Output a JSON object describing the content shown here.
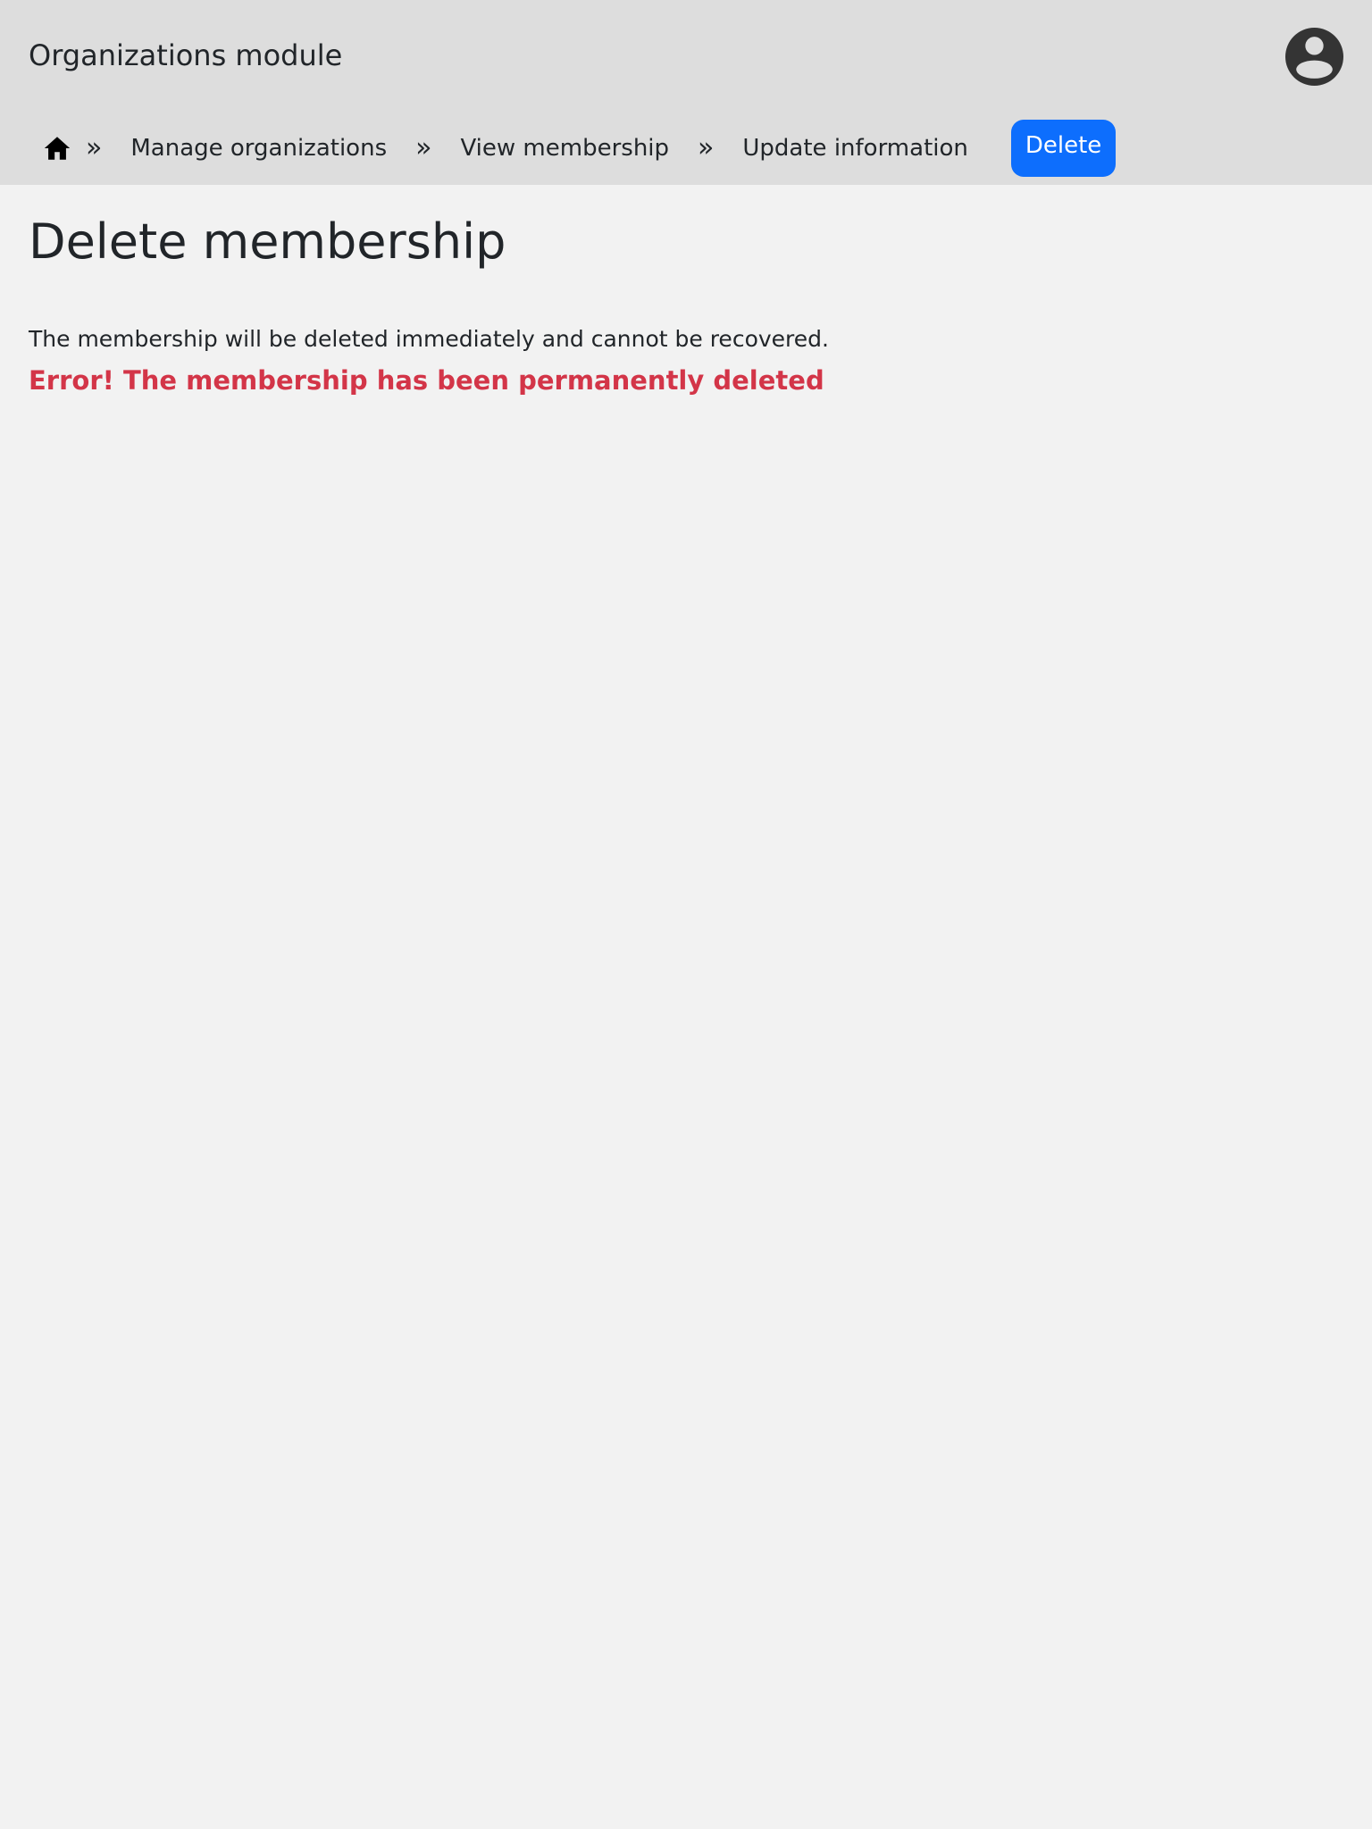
{
  "header": {
    "app_title": "Organizations module",
    "avatar_icon": "user-circle-icon"
  },
  "breadcrumb": {
    "home_icon": "home-icon",
    "separator": "»",
    "items": [
      {
        "label": "Manage organizations"
      },
      {
        "label": "View membership"
      },
      {
        "label": "Update information"
      }
    ],
    "action_button": {
      "label": "Delete",
      "color": "#0d6efd"
    }
  },
  "main": {
    "title": "Delete membership",
    "description": "The membership will be deleted immediately and cannot be recovered.",
    "error_message": "Error! The membership has been permanently deleted",
    "error_color": "#d33548"
  }
}
